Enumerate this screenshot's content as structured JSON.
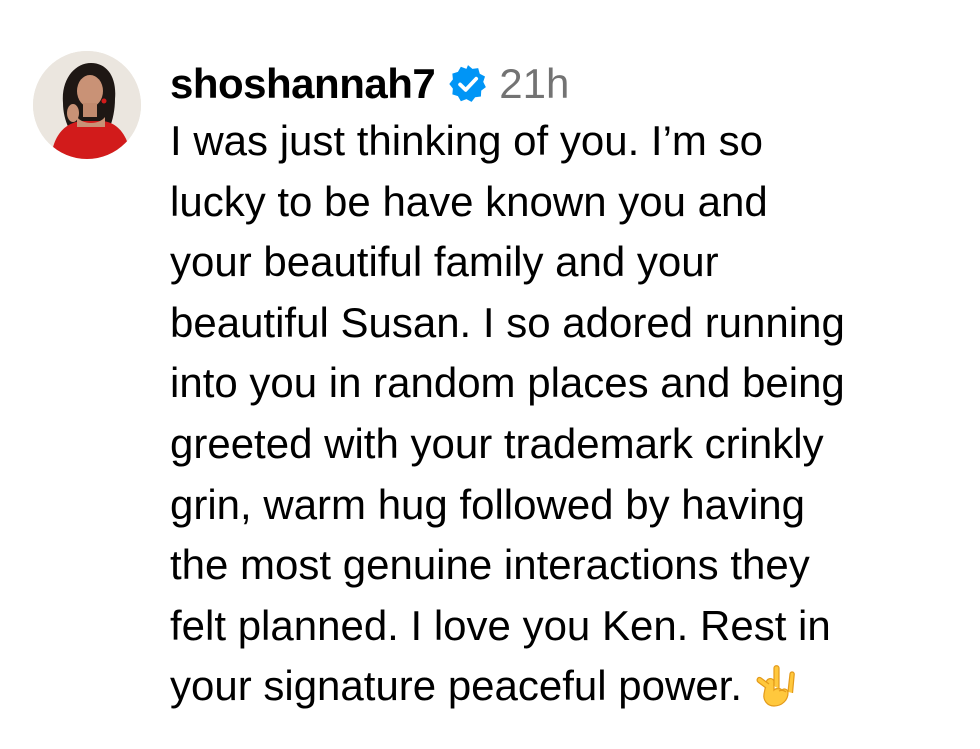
{
  "comment": {
    "username": "shoshannah7",
    "timestamp": "21h",
    "verified_icon": "verified-badge-icon",
    "verified_color": "#0095f6",
    "lines": [
      "I was just thinking of you. I’m so",
      "lucky to be have known you and",
      "your beautiful family and your",
      "beautiful Susan. I so adored running",
      "into you in random places and being",
      "greeted with your trademark crinkly",
      "grin, warm hug followed by having",
      "the most genuine interactions they",
      "felt planned. I love you Ken. Rest in",
      "your signature peaceful power."
    ],
    "trailing_emoji": "love-you-gesture-emoji"
  }
}
